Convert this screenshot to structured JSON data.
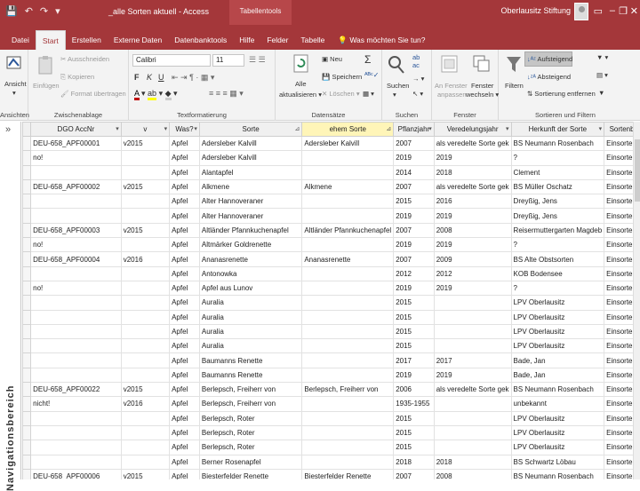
{
  "window": {
    "title": "_alle Sorten aktuell  -  Access",
    "context_tab": "Tabellentools",
    "user": "Oberlausitz Stiftung",
    "qat": [
      "💾",
      "↶",
      "↷",
      "▾"
    ]
  },
  "ribbon_tabs": [
    "Datei",
    "Start",
    "Erstellen",
    "Externe Daten",
    "Datenbanktools",
    "Hilfe",
    "Felder",
    "Tabelle"
  ],
  "active_tab": "Start",
  "tell_me": "Was möchten Sie tun?",
  "ribbon": {
    "ansichten": {
      "label": "Ansichten",
      "button": "Ansicht"
    },
    "zwischenablage": {
      "label": "Zwischenablage",
      "einfuegen": "Einfügen",
      "ausschneiden": "Ausschneiden",
      "kopieren": "Kopieren",
      "format": "Format übertragen"
    },
    "textformatierung": {
      "label": "Textformatierung",
      "font": "Calibri",
      "size": "11",
      "bold": "F",
      "italic": "K",
      "underline": "U"
    },
    "datensaetze": {
      "label": "Datensätze",
      "alle": "Alle",
      "aktualisieren": "aktualisieren ▾",
      "neu": "Neu",
      "speichern": "Speichern",
      "loeschen": "Löschen"
    },
    "suchen": {
      "label": "Suchen",
      "suchen": "Suchen"
    },
    "fenster": {
      "label": "Fenster",
      "anpassen1": "An Fenster",
      "anpassen2": "anpassen",
      "wechseln1": "Fenster",
      "wechseln2": "wechseln ▾"
    },
    "sortieren": {
      "label": "Sortieren und Filtern",
      "filtern": "Filtern",
      "aufsteigend": "Aufsteigend",
      "absteigend": "Absteigend",
      "entfernen": "Sortierung entfernen"
    }
  },
  "nav_pane": {
    "label": "Navigationsbereich",
    "collapse": "»"
  },
  "table": {
    "columns": [
      "DGO AccNr",
      "v",
      "Was?",
      "Sorte",
      "ehem Sorte",
      "Pflanzjahr",
      "Veredelungsjahr",
      "Herkunft der Sorte",
      "Sortenb"
    ],
    "rows": [
      [
        "DEU-658_APF00001",
        "v2015",
        "Apfel",
        "Adersleber Kalvill",
        "Adersleber Kalvill",
        "2007",
        "als veredelte Sorte gek",
        "BS Neumann Rosenbach",
        "Einsorten"
      ],
      [
        "no!",
        "",
        "Apfel",
        "Adersleber Kalvill",
        "",
        "2019",
        "2019",
        "?",
        "Einsorten"
      ],
      [
        "",
        "",
        "Apfel",
        "Alantapfel",
        "",
        "2014",
        "2018",
        "Clement",
        "Einsorten"
      ],
      [
        "DEU-658_APF00002",
        "v2015",
        "Apfel",
        "Alkmene",
        "Alkmene",
        "2007",
        "als veredelte Sorte gek",
        "BS Müller Oschatz",
        "Einsorten"
      ],
      [
        "",
        "",
        "Apfel",
        "Alter Hannoveraner",
        "",
        "2015",
        "2016",
        "Dreyßig, Jens",
        "Einsorten"
      ],
      [
        "",
        "",
        "Apfel",
        "Alter Hannoveraner",
        "",
        "2019",
        "2019",
        "Dreyßig, Jens",
        "Einsorten"
      ],
      [
        "DEU-658_APF00003",
        "v2015",
        "Apfel",
        "Altländer Pfannkuchenapfel",
        "Altländer Pfannkuchenapfel",
        "2007",
        "2008",
        "Reisermuttergarten Magdeb",
        "Einsorten"
      ],
      [
        "no!",
        "",
        "Apfel",
        "Altmärker Goldrenette",
        "",
        "2019",
        "2019",
        "?",
        "Einsorten"
      ],
      [
        "DEU-658_APF00004",
        "v2016",
        "Apfel",
        "Ananasrenette",
        "Ananasrenette",
        "2007",
        "2009",
        "BS Alte Obstsorten",
        "Einsorten"
      ],
      [
        "",
        "",
        "Apfel",
        "Antonowka",
        "",
        "2012",
        "2012",
        "KOB Bodensee",
        "Einsorten"
      ],
      [
        "no!",
        "",
        "Apfel",
        "Apfel aus Lunov",
        "",
        "2019",
        "2019",
        "?",
        "Einsorten"
      ],
      [
        "",
        "",
        "Apfel",
        "Auralia",
        "",
        "2015",
        "",
        "LPV Oberlausitz",
        "Einsorten"
      ],
      [
        "",
        "",
        "Apfel",
        "Auralia",
        "",
        "2015",
        "",
        "LPV Oberlausitz",
        "Einsorten"
      ],
      [
        "",
        "",
        "Apfel",
        "Auralia",
        "",
        "2015",
        "",
        "LPV Oberlausitz",
        "Einsorten"
      ],
      [
        "",
        "",
        "Apfel",
        "Auralia",
        "",
        "2015",
        "",
        "LPV Oberlausitz",
        "Einsorten"
      ],
      [
        "",
        "",
        "Apfel",
        "Baumanns Renette",
        "",
        "2017",
        "2017",
        "Bade, Jan",
        "Einsorten"
      ],
      [
        "",
        "",
        "Apfel",
        "Baumanns Renette",
        "",
        "2019",
        "2019",
        "Bade, Jan",
        "Einsorten"
      ],
      [
        "DEU-658_APF00022",
        "v2015",
        "Apfel",
        "Berlepsch, Freiherr von",
        "Berlepsch, Freiherr von",
        "2006",
        "als veredelte Sorte gek",
        "BS Neumann Rosenbach",
        "Einsorten"
      ],
      [
        "nicht!",
        "v2016",
        "Apfel",
        "Berlepsch, Freiherr von",
        "",
        "1935-1955",
        "",
        "unbekannt",
        "Einsorten"
      ],
      [
        "",
        "",
        "Apfel",
        "Berlepsch, Roter",
        "",
        "2015",
        "",
        "LPV Oberlausitz",
        "Einsorten"
      ],
      [
        "",
        "",
        "Apfel",
        "Berlepsch, Roter",
        "",
        "2015",
        "",
        "LPV Oberlausitz",
        "Einsorten"
      ],
      [
        "",
        "",
        "Apfel",
        "Berlepsch, Roter",
        "",
        "2015",
        "",
        "LPV Oberlausitz",
        "Einsorten"
      ],
      [
        "",
        "",
        "Apfel",
        "Berner Rosenapfel",
        "",
        "2018",
        "2018",
        "BS Schwartz Löbau",
        "Einsorten"
      ],
      [
        "DEU-658_APF00006",
        "v2015",
        "Apfel",
        "Biesterfelder Renette",
        "Biesterfelder Renette",
        "2007",
        "2008",
        "BS Neumann Rosenbach",
        "Einsorten"
      ]
    ]
  },
  "colors": {
    "accent": "#a4373a",
    "sort_header": "#fff5b8"
  }
}
